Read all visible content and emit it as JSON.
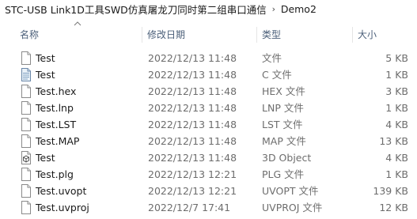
{
  "breadcrumb": {
    "segments": [
      "STC-USB Link1D工具SWD仿真屠龙刀同时第二组串口通信",
      "Demo2"
    ]
  },
  "columns": {
    "name": "名称",
    "date": "修改日期",
    "type": "类型",
    "size": "大小",
    "sort": "ascending"
  },
  "files": [
    {
      "name": "Test",
      "date": "2022/12/13 11:48",
      "type": "文件",
      "size": "5 KB",
      "icon": "blank-file-icon"
    },
    {
      "name": "Test",
      "date": "2022/12/13 11:48",
      "type": "C 文件",
      "size": "1 KB",
      "icon": "c-source-file-icon"
    },
    {
      "name": "Test.hex",
      "date": "2022/12/13 11:48",
      "type": "HEX 文件",
      "size": "3 KB",
      "icon": "blank-file-icon"
    },
    {
      "name": "Test.lnp",
      "date": "2022/12/13 11:48",
      "type": "LNP 文件",
      "size": "1 KB",
      "icon": "blank-file-icon"
    },
    {
      "name": "Test.LST",
      "date": "2022/12/13 11:48",
      "type": "LST 文件",
      "size": "4 KB",
      "icon": "blank-file-icon"
    },
    {
      "name": "Test.MAP",
      "date": "2022/12/13 11:48",
      "type": "MAP 文件",
      "size": "13 KB",
      "icon": "blank-file-icon"
    },
    {
      "name": "Test",
      "date": "2022/12/13 11:48",
      "type": "3D Object",
      "size": "4 KB",
      "icon": "3d-object-file-icon"
    },
    {
      "name": "Test.plg",
      "date": "2022/12/13 12:21",
      "type": "PLG 文件",
      "size": "1 KB",
      "icon": "blank-file-icon"
    },
    {
      "name": "Test.uvopt",
      "date": "2022/12/13 12:21",
      "type": "UVOPT 文件",
      "size": "139 KB",
      "icon": "blank-file-icon"
    },
    {
      "name": "Test.uvproj",
      "date": "2022/12/7 17:41",
      "type": "UVPROJ 文件",
      "size": "12 KB",
      "icon": "blank-file-icon"
    }
  ]
}
